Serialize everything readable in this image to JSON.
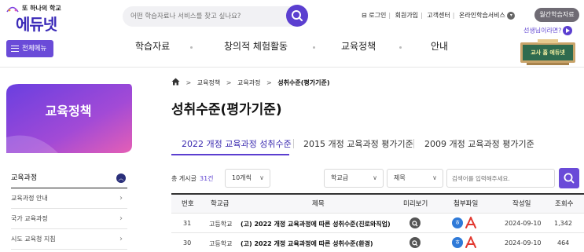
{
  "header": {
    "logo_tagline": "또 하나의 학교",
    "logo_name": "에듀넷",
    "search_placeholder": "어떤 학습자료나 서비스를 찾고 싶나요?",
    "util_links": [
      "로그인",
      "회원가입",
      "고객센터",
      "온라인학습서비스"
    ],
    "monthly_button": "월간학습자료",
    "teacher_question": "선생님이라면?",
    "allmenu_label": "전체메뉴",
    "gnb": [
      "학습자료",
      "창의적 체험활동",
      "교육정책",
      "안내"
    ],
    "board_text": "교사 홈 에듀넷"
  },
  "sidebar": {
    "title": "교육정책",
    "section": "교육과정",
    "items": [
      "교육과정 안내",
      "국가 교육과정",
      "시도 교육청 지침"
    ]
  },
  "content": {
    "breadcrumb": [
      "교육정책",
      "교육과정",
      "성취수준(평가기준)"
    ],
    "page_title": "성취수준(평가기준)",
    "tabs": [
      "2022 개정 교육과정 성취수준",
      "2015 개정 교육과정 평가기준",
      "2009 개정 교육과정 평가기준"
    ],
    "total_label": "총 게시글",
    "total_count": "31건",
    "per_page": "10개씩",
    "school_select": "학교급",
    "field_select": "제목",
    "keyword_placeholder": "검색어를 입력해주세요.",
    "columns": [
      "번호",
      "학교급",
      "제목",
      "미리보기",
      "첨부파일",
      "작성일",
      "조회수"
    ],
    "rows": [
      {
        "no": "31",
        "level": "고등학교",
        "title": "(고) 2022 개정 교육과정에 따른 성취수준(진로와직업)",
        "date": "2024-09-10",
        "views": "1,342"
      },
      {
        "no": "30",
        "level": "고등학교",
        "title": "(고) 2022 개정 교육과정에 따른 성취수준(환경)",
        "date": "2024-09-10",
        "views": "464"
      }
    ]
  },
  "colors": {
    "accent": "#5b3fd0",
    "sidebar_gradient_start": "#7b3fe0",
    "sidebar_gradient_end": "#e75fb8",
    "pdf": "#e2382f",
    "hwp": "#2f7ad8"
  }
}
